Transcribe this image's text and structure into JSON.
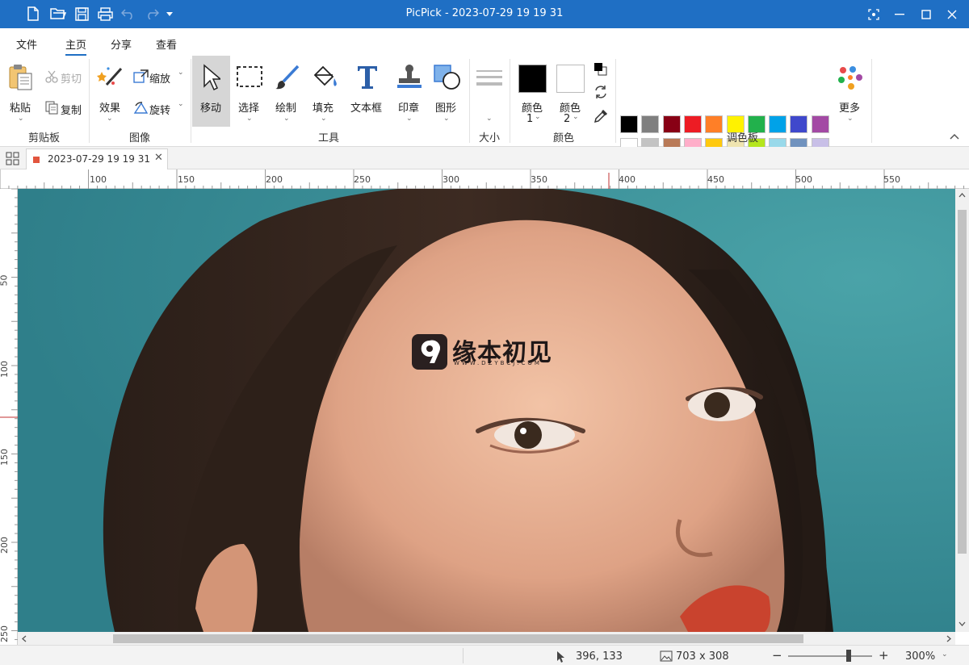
{
  "window": {
    "title": "PicPick - 2023-07-29 19 19 31"
  },
  "quick_access": {
    "icons": [
      "new-file-icon",
      "open-folder-icon",
      "save-icon",
      "print-icon",
      "undo-icon",
      "redo-icon",
      "customize-dropdown-icon"
    ]
  },
  "window_controls": {
    "icons": [
      "capture-icon",
      "minimize-icon",
      "maximize-icon",
      "close-icon"
    ]
  },
  "menu": {
    "items": [
      {
        "label": "文件"
      },
      {
        "label": "主页"
      },
      {
        "label": "分享"
      },
      {
        "label": "查看"
      }
    ],
    "active": "主页"
  },
  "ribbon": {
    "clipboard": {
      "group": "剪贴板",
      "paste": "粘贴",
      "cut": "剪切",
      "copy": "复制"
    },
    "image": {
      "group": "图像",
      "effects": "效果",
      "resize": "缩放",
      "rotate": "旋转"
    },
    "tools": {
      "group": "工具",
      "move": "移动",
      "select": "选择",
      "draw": "绘制",
      "fill": "填充",
      "textbox": "文本框",
      "stamp": "印章",
      "shape": "图形"
    },
    "size": {
      "group": "大小"
    },
    "colors": {
      "group": "颜色",
      "color1": "颜色",
      "color1_num": "1",
      "color2": "颜色",
      "color2_num": "2",
      "color1_value": "#000000",
      "color2_value": "#ffffff"
    },
    "palette": {
      "group": "调色板",
      "more": "更多",
      "row1": [
        "#000000",
        "#7f7f7f",
        "#880015",
        "#ed1c24",
        "#ff7f27",
        "#fff200",
        "#22b14c",
        "#00a2e8",
        "#3f48cc",
        "#a349a4"
      ],
      "row2": [
        "#ffffff",
        "#c3c3c3",
        "#b97a57",
        "#ffaec9",
        "#ffc90e",
        "#efe4b0",
        "#b5e61d",
        "#99d9ea",
        "#7092be",
        "#c8bfe7"
      ]
    }
  },
  "tab": {
    "label": "2023-07-29 19 19 31"
  },
  "ruler": {
    "h_labels": [
      "100",
      "150",
      "200",
      "250",
      "300",
      "350",
      "400",
      "450",
      "500",
      "550"
    ],
    "v_labels": [
      "50",
      "100",
      "150",
      "200",
      "250"
    ]
  },
  "watermark": {
    "text": "缘本初见",
    "url": "WWW.DZYBCJ.COM"
  },
  "statusbar": {
    "cursor": "396, 133",
    "image_size": "703 x 308",
    "zoom": "300%"
  }
}
